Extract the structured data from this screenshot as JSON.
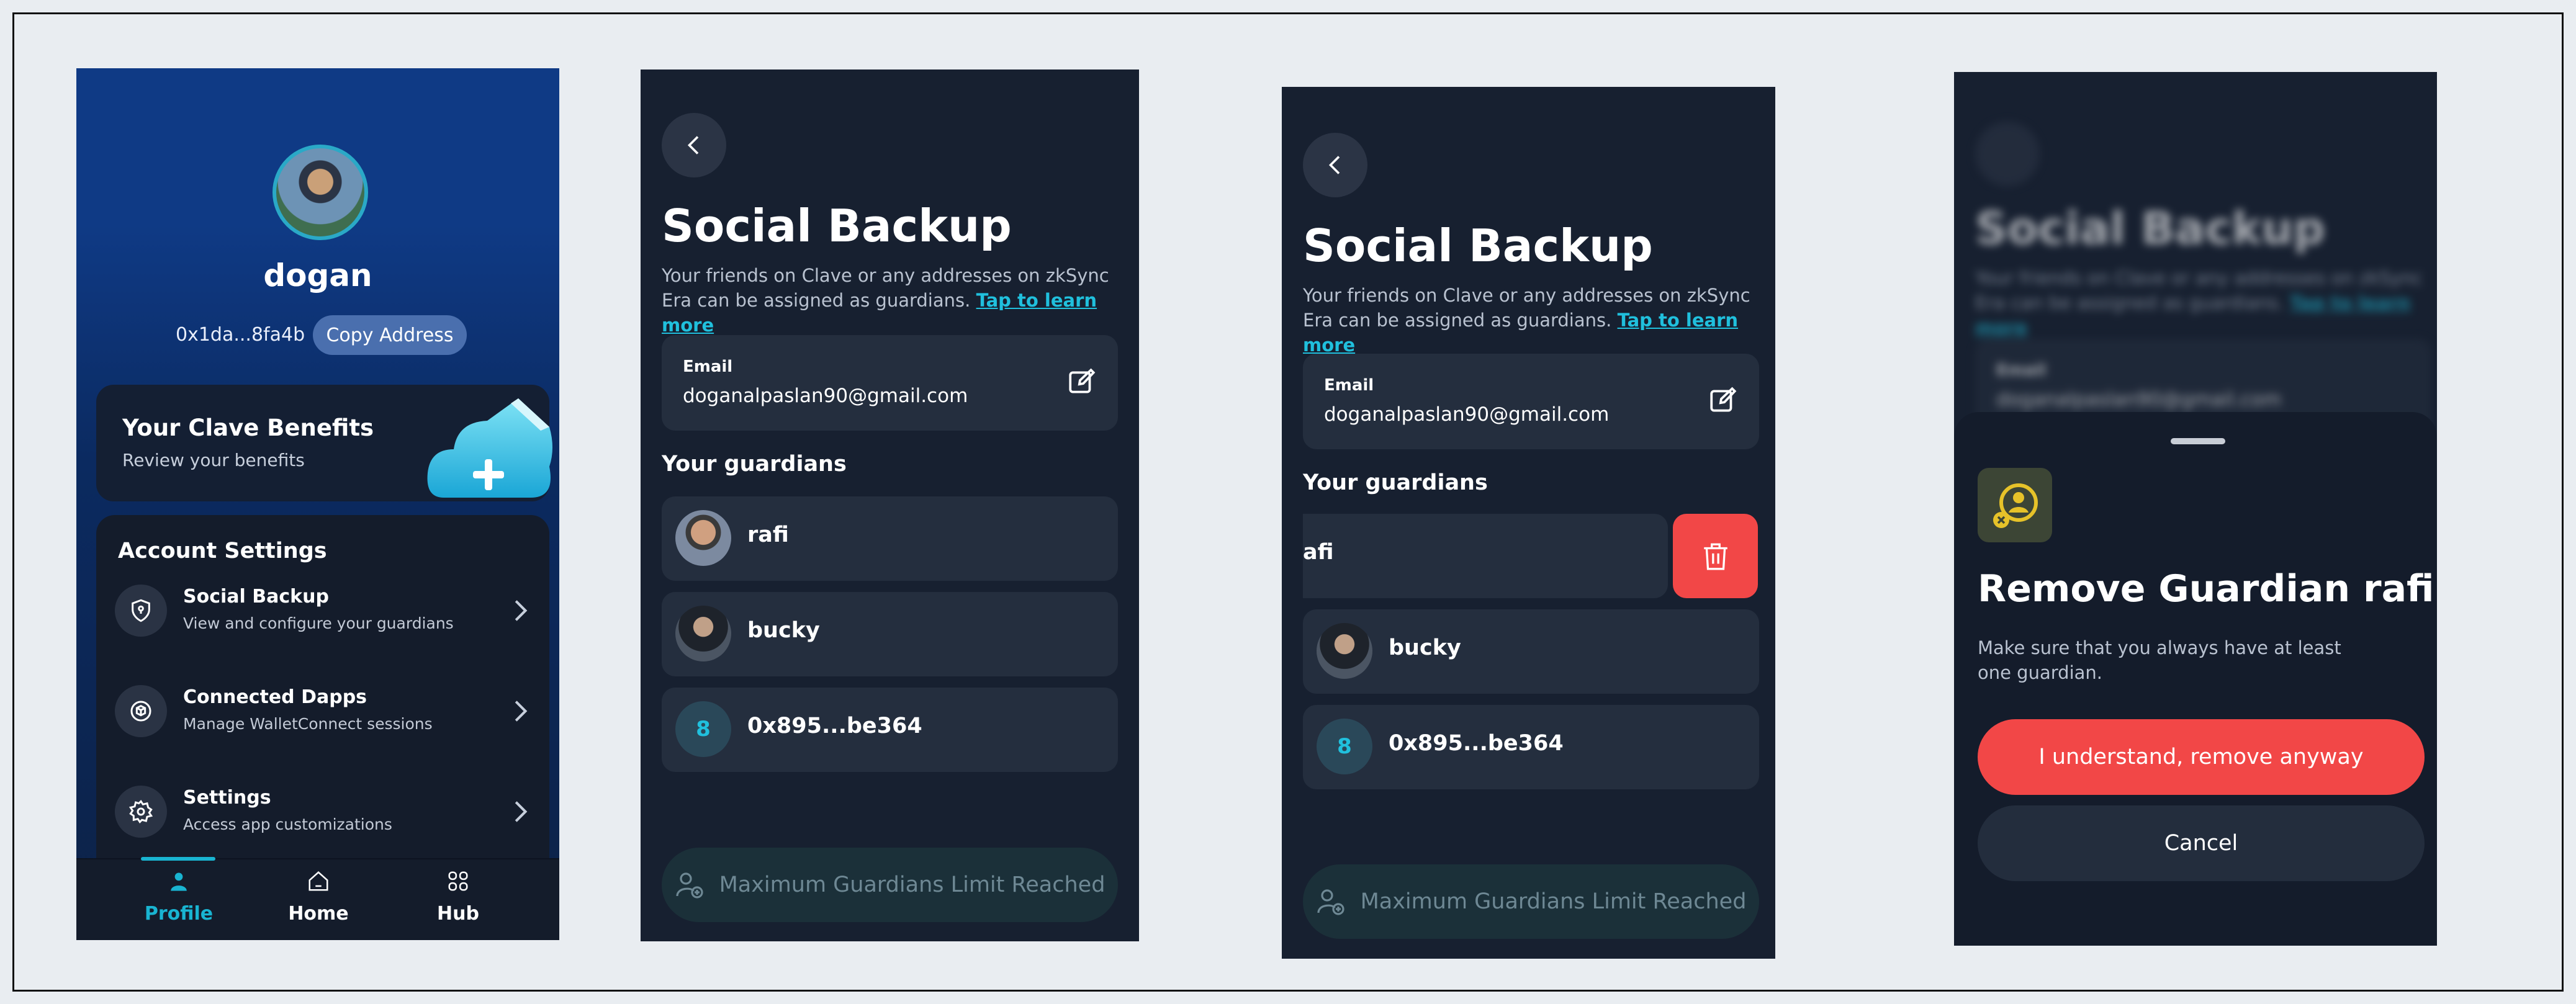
{
  "profile": {
    "username": "dogan",
    "address": "0x1da...8fa4b",
    "copy_label": "Copy Address",
    "benefits_title": "Your Clave Benefits",
    "benefits_subtitle": "Review your benefits",
    "account_settings_title": "Account Settings",
    "items": [
      {
        "title": "Social Backup",
        "subtitle": "View and configure your guardians",
        "icon": "shield-icon"
      },
      {
        "title": "Connected Dapps",
        "subtitle": "Manage WalletConnect sessions",
        "icon": "cube-icon"
      },
      {
        "title": "Settings",
        "subtitle": "Access app customizations",
        "icon": "gear-icon"
      }
    ],
    "tabs": [
      {
        "label": "Profile",
        "icon": "person-icon",
        "active": true
      },
      {
        "label": "Home",
        "icon": "home-icon",
        "active": false
      },
      {
        "label": "Hub",
        "icon": "grid-icon",
        "active": false
      }
    ]
  },
  "social_backup": {
    "title": "Social Backup",
    "description": "Your friends on Clave or any addresses on zkSync Era can be assigned as guardians.",
    "learn_more": "Tap to learn more",
    "email_label": "Email",
    "email_value": "doganalpaslan90@gmail.com",
    "guardians_title": "Your guardians",
    "guardians": [
      {
        "name": "rafi"
      },
      {
        "name": "bucky"
      },
      {
        "name": "0x895...be364",
        "badge": "8"
      }
    ],
    "swiped_name": "afi",
    "max_label": "Maximum Guardians Limit Reached"
  },
  "remove_dialog": {
    "title": "Remove Guardian rafi",
    "description": "Make sure that you always have at least one guardian.",
    "confirm_label": "I understand, remove anyway",
    "cancel_label": "Cancel"
  },
  "colors": {
    "accent": "#20c0dd",
    "danger": "#f24747",
    "background": "#172030"
  }
}
